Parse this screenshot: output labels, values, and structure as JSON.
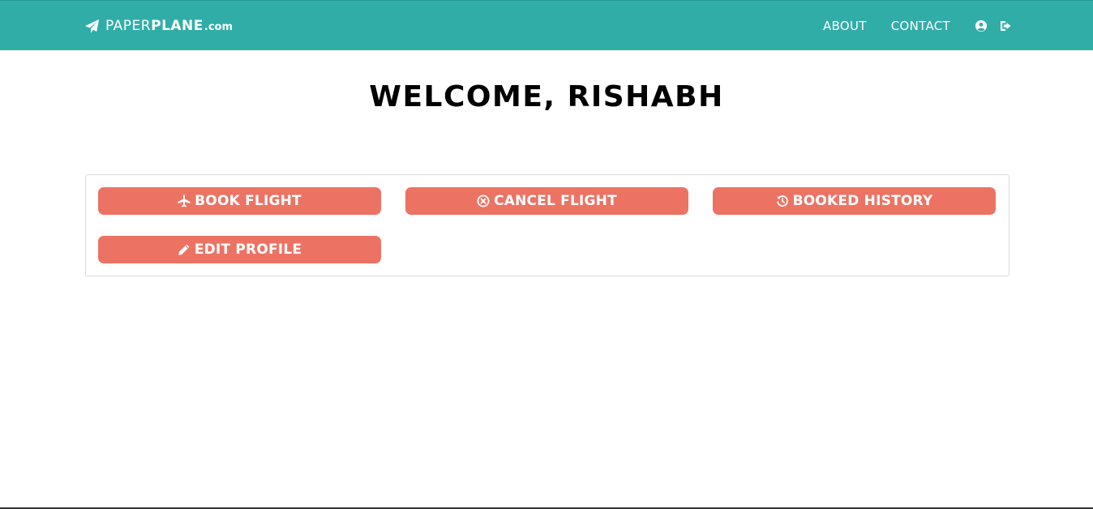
{
  "brand": {
    "light": "PAPER",
    "bold": "PLANE",
    "suffix": ".com"
  },
  "nav": {
    "about": "ABOUT",
    "contact": "CONTACT",
    "profile_icon": "user-circle-icon",
    "logout_icon": "sign-out-icon"
  },
  "page": {
    "title": "WELCOME, RISHABH"
  },
  "actions": {
    "book": {
      "label": "BOOK FLIGHT",
      "icon": "plane-icon"
    },
    "cancel": {
      "label": "CANCEL FLIGHT",
      "icon": "times-circle-icon"
    },
    "history": {
      "label": "BOOKED HISTORY",
      "icon": "history-icon"
    },
    "edit": {
      "label": "EDIT PROFILE",
      "icon": "pencil-icon"
    }
  },
  "colors": {
    "navbar": "#31ada8",
    "button": "#ec7363",
    "text_on_color": "#ffffff"
  }
}
